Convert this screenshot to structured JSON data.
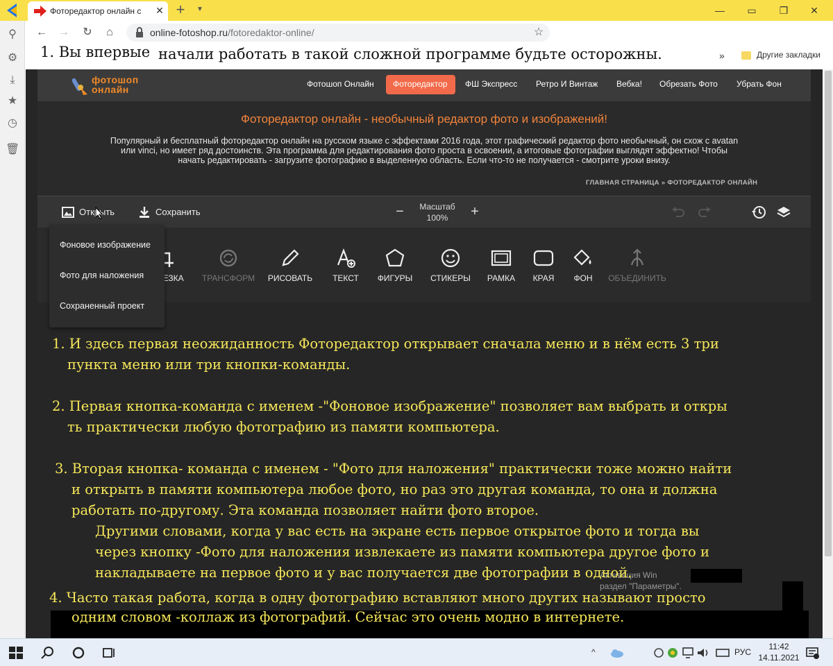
{
  "browser": {
    "tab_title": "Фоторедактор онлайн с",
    "url_domain": "online-fotoshop.ru",
    "url_path": "/fotoredaktor-online/",
    "bookmarks_other": "Другие закладки",
    "bookmarks_more": "»"
  },
  "annotation_top": {
    "part1": "1. Вы впервые",
    "part2": "начали работать в такой сложной программе будьте осторожны."
  },
  "site": {
    "logo_line1": "фотошоп",
    "logo_line2": "онлайн",
    "nav": [
      "Фотошоп Онлайн",
      "Фоторедактор",
      "ФШ Экспресс",
      "Ретро И Винтаж",
      "Вебка!",
      "Обрезать Фото",
      "Убрать Фон"
    ],
    "hero_title": "Фоторедактор онлайн - необычный редактор фото и изображений!",
    "hero_desc_line1": "Популярный и бесплатный фоторедактор онлайн на русском языке с эффектами 2016 года, этот графический редактор фото необычный, он схож с avatan",
    "hero_desc_line2": "или vinci, но имеет ряд достоинств. Эта программа для редактирования фото проста в освоении, а итоговые фотографии выглядят эффектно! Чтобы",
    "hero_desc_line3": "начать редактировать - загрузите фотографию в выделенную область. Если что-то не получается - смотрите уроки внизу.",
    "breadcrumb_home": "ГЛАВНАЯ СТРАНИЦА",
    "breadcrumb_sep": "»",
    "breadcrumb_current": "ФОТОРЕДАКТОР ОНЛАЙН"
  },
  "editor": {
    "open_label": "Открыть",
    "save_label": "Сохранить",
    "zoom_label": "Масштаб",
    "zoom_value": "100%",
    "tools": [
      {
        "label": "ОБРЕЗКА",
        "icon": "crop-icon",
        "disabled": false
      },
      {
        "label": "ТРАНСФОРМ",
        "icon": "transform-icon",
        "disabled": true
      },
      {
        "label": "РИСОВАТЬ",
        "icon": "pencil-icon",
        "disabled": false
      },
      {
        "label": "ТЕКСТ",
        "icon": "text-icon",
        "disabled": false
      },
      {
        "label": "ФИГУРЫ",
        "icon": "shapes-icon",
        "disabled": false
      },
      {
        "label": "СТИКЕРЫ",
        "icon": "smiley-icon",
        "disabled": false
      },
      {
        "label": "РАМКА",
        "icon": "frame-icon",
        "disabled": false
      },
      {
        "label": "КРАЯ",
        "icon": "edges-icon",
        "disabled": false
      },
      {
        "label": "ФОН",
        "icon": "paint-bucket-icon",
        "disabled": false
      },
      {
        "label": "ОБЪЕДИНИТЬ",
        "icon": "merge-icon",
        "disabled": true
      }
    ],
    "open_menu": [
      "Фоновое изображение",
      "Фото для наложения",
      "Сохраненный проект"
    ]
  },
  "annotations": {
    "p1_line1": "1. И здесь первая неожиданность Фоторедактор открывает сначала меню и в нём есть 3 три",
    "p1_line2": "пункта меню или три кнопки-команды.",
    "p2_line1": "2. Первая кнопка-команда с именем -\"Фоновое изображение\" позволяет вам выбрать и откры",
    "p2_line2": "ть практически любую фотографию из памяти компьютера.",
    "p3_line1": "3. Вторая кнопка- команда с именем - \"Фото для наложения\" практически тоже можно найти",
    "p3_line2": "и открыть в памяти компьютера любое фото, но раз это другая команда, то она и должна",
    "p3_line3": "работать по-другому. Эта команда позволяет найти фото второе.",
    "p3_line4": "Другими словами, когда у вас есть на экране есть первое открытое фото и тогда вы",
    "p3_line5": "через кнопку -Фото для наложения извлекаете из памяти компьютера другое фото и",
    "p3_line6": "накладываете на первое фото и у вас получается две фотографии в одной.",
    "p4_line1": "4. Часто такая работа, когда в одну фотографию вставляют много других называют просто",
    "p4_line2": "одним словом -коллаж из фотографий. Сейчас это очень модно в интернете."
  },
  "watermark": {
    "line1": "Активация Win",
    "line2": "раздел \"Параметры\"."
  },
  "taskbar": {
    "lang": "РУС",
    "time": "11:42",
    "date": "14.11.2021"
  },
  "colors": {
    "accent": "#f26a4a",
    "hero_title": "#f2853d",
    "annotation": "#f7e85a",
    "browser_bar": "#f9e04b"
  }
}
